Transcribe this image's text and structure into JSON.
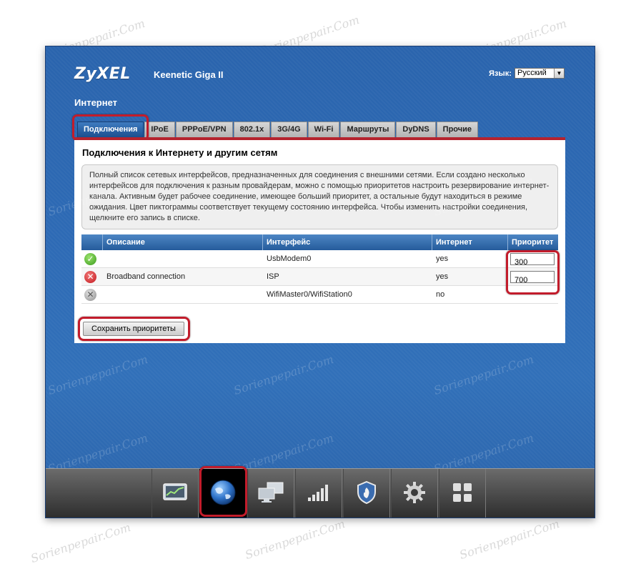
{
  "header": {
    "brand": "ZyXEL",
    "model": "Keenetic Giga II",
    "language_label": "Язык:",
    "language_value": "Русский"
  },
  "page_title": "Интернет",
  "tabs": [
    {
      "label": "Подключения",
      "active": true
    },
    {
      "label": "IPoE",
      "active": false
    },
    {
      "label": "PPPoE/VPN",
      "active": false
    },
    {
      "label": "802.1x",
      "active": false
    },
    {
      "label": "3G/4G",
      "active": false
    },
    {
      "label": "Wi-Fi",
      "active": false
    },
    {
      "label": "Маршруты",
      "active": false
    },
    {
      "label": "DyDNS",
      "active": false
    },
    {
      "label": "Прочие",
      "active": false
    }
  ],
  "panel": {
    "heading": "Подключения к Интернету и другим сетям",
    "info": "Полный список сетевых интерфейсов, предназначенных для соединения с внешними сетями. Если создано несколько интерфейсов для подключения к разным провайдерам, можно с помощью приоритетов настроить резервирование интернет-канала. Активным будет рабочее соединение, имеющее больший приоритет, а остальные будут находиться в режиме ожидания. Цвет пиктограммы соответствует текущему состоянию интерфейса. Чтобы изменить настройки соединения, щелкните его запись в списке."
  },
  "table": {
    "columns": {
      "description": "Описание",
      "interface": "Интерфейс",
      "internet": "Интернет",
      "priority": "Приоритет"
    },
    "rows": [
      {
        "status": "ok",
        "description": "",
        "interface": "UsbModem0",
        "internet": "yes",
        "priority": "300"
      },
      {
        "status": "error",
        "description": "Broadband connection",
        "interface": "ISP",
        "internet": "yes",
        "priority": "700"
      },
      {
        "status": "disabled",
        "description": "",
        "interface": "WifiMaster0/WifiStation0",
        "internet": "no",
        "priority": ""
      }
    ]
  },
  "save_button": "Сохранить приоритеты",
  "dock": [
    {
      "icon": "monitor-chart-icon",
      "active": false
    },
    {
      "icon": "globe-icon",
      "active": true
    },
    {
      "icon": "network-computers-icon",
      "active": false
    },
    {
      "icon": "signal-bars-icon",
      "active": false
    },
    {
      "icon": "shield-fire-icon",
      "active": false
    },
    {
      "icon": "gear-icon",
      "active": false
    },
    {
      "icon": "apps-grid-icon",
      "active": false
    }
  ],
  "watermark": "Sorienpepair.Com",
  "colors": {
    "accent": "#b5232e",
    "frame_blue": "#2d6ab5",
    "tab_active": "#1c4f8f",
    "highlight": "#c21c2b"
  }
}
